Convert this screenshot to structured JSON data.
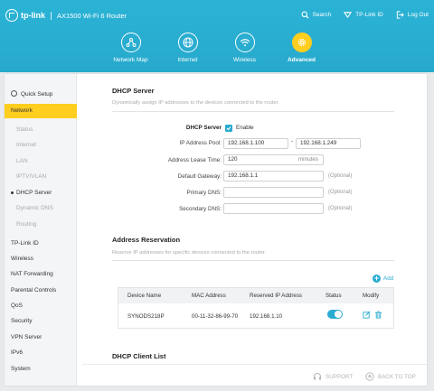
{
  "header": {
    "logo_text": "tp-link",
    "product_name": "AX1500 Wi-Fi 6 Router",
    "links": [
      {
        "label": "Search",
        "icon": "search-icon"
      },
      {
        "label": "TP-Link ID",
        "icon": "tplink-id-icon"
      },
      {
        "label": "Log Out",
        "icon": "logout-icon"
      }
    ],
    "tabs": [
      {
        "label": "Network Map",
        "icon": "network-map-icon",
        "active": false
      },
      {
        "label": "Internet",
        "icon": "globe-icon",
        "active": false
      },
      {
        "label": "Wireless",
        "icon": "wifi-icon",
        "active": false
      },
      {
        "label": "Advanced",
        "icon": "gear-icon",
        "active": true
      }
    ]
  },
  "sidebar": {
    "quick_setup": "Quick Setup",
    "items": [
      {
        "label": "Network",
        "level": 0,
        "selected": true
      },
      {
        "label": "Status",
        "level": 1
      },
      {
        "label": "Internet",
        "level": 1
      },
      {
        "label": "LAN",
        "level": 1
      },
      {
        "label": "IPTV/VLAN",
        "level": 1
      },
      {
        "label": "DHCP Server",
        "level": 1,
        "active": true
      },
      {
        "label": "Dynamic DNS",
        "level": 1
      },
      {
        "label": "Routing",
        "level": 1
      },
      {
        "label": "TP-Link ID",
        "level": 0
      },
      {
        "label": "Wireless",
        "level": 0
      },
      {
        "label": "NAT Forwarding",
        "level": 0
      },
      {
        "label": "Parental Controls",
        "level": 0
      },
      {
        "label": "QoS",
        "level": 0
      },
      {
        "label": "Security",
        "level": 0
      },
      {
        "label": "VPN Server",
        "level": 0
      },
      {
        "label": "IPv6",
        "level": 0
      },
      {
        "label": "System",
        "level": 0
      }
    ]
  },
  "dhcp_server": {
    "title": "DHCP Server",
    "description": "Dynamically assign IP addresses to the devices connected to the router.",
    "enable_label": "DHCP Server",
    "enable_checkbox_label": "Enable",
    "enabled": true,
    "pool_label": "IP Address Pool:",
    "pool_start": "192.168.1.100",
    "pool_separator": "-",
    "pool_end": "192.168.1.249",
    "lease_label": "Address Lease Time:",
    "lease_value": "120",
    "lease_unit": "minutes",
    "gateway_label": "Default Gateway:",
    "gateway_value": "192.168.1.1",
    "primary_dns_label": "Primary DNS:",
    "primary_dns_value": "",
    "secondary_dns_label": "Secondary DNS:",
    "secondary_dns_value": "",
    "optional_text": "(Optional)"
  },
  "reservation": {
    "title": "Address Reservation",
    "description": "Reserve IP addresses for specific devices connected to the router.",
    "add_label": "Add",
    "columns": [
      "Device Name",
      "MAC Address",
      "Reserved IP Address",
      "Status",
      "Modify"
    ],
    "rows": [
      {
        "device": "SYNODS218P",
        "mac": "00-11-32-86-99-70",
        "ip": "192.168.1.10",
        "status_on": true
      }
    ]
  },
  "client_list": {
    "title": "DHCP Client List"
  },
  "footer": {
    "support_label": "SUPPORT",
    "back_to_top_label": "BACK TO TOP"
  },
  "colors": {
    "brand": "#29abd0",
    "highlight": "#ffce1f"
  }
}
